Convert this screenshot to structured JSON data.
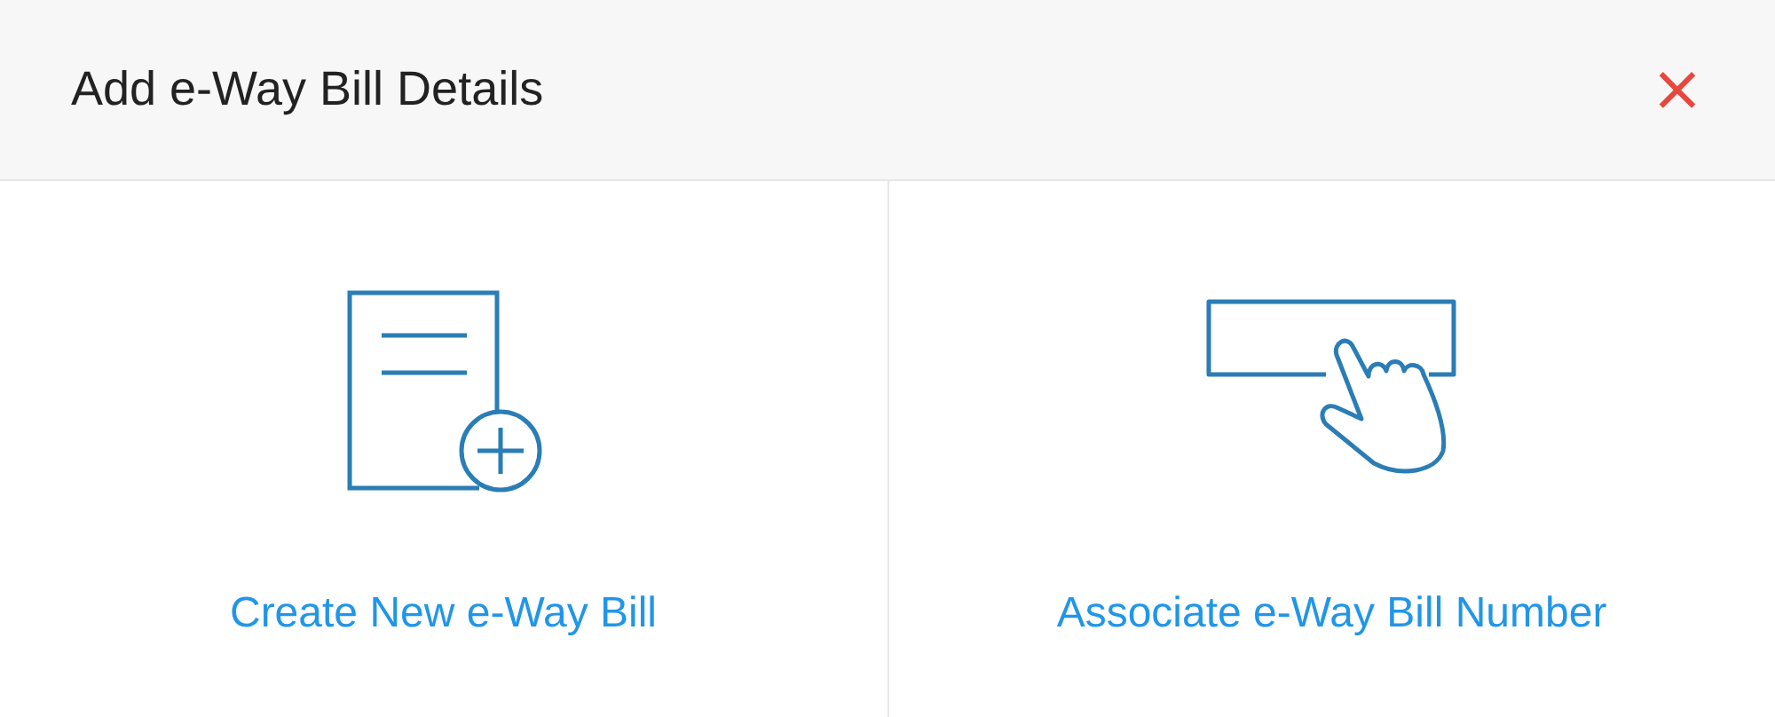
{
  "dialog": {
    "title": "Add e-Way Bill Details",
    "close": "×"
  },
  "options": [
    {
      "kind": "document-plus",
      "label": "Create New e-Way Bill"
    },
    {
      "kind": "hand-tap",
      "label": "Associate e-Way Bill Number"
    }
  ]
}
